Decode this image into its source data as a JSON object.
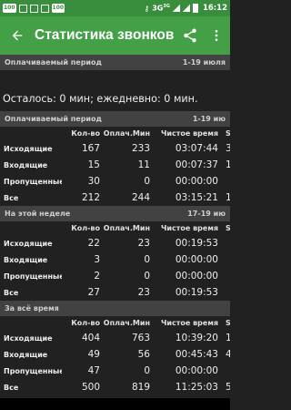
{
  "statusbar": {
    "notification_count": "100",
    "network": "3G",
    "network_sup": "3G",
    "time": "16:12"
  },
  "appbar": {
    "title": "Статистика звонков"
  },
  "billing": {
    "header_label": "Оплачиваемый период",
    "header_range": "1-19 июля",
    "remaining_text": "Осталось: 0 мин; ежедневно: 0 мин."
  },
  "columns": [
    "Кол-во",
    "Оплач.Мин",
    "Чистое время",
    "SI"
  ],
  "sections": [
    {
      "label": "Оплачиваемый период",
      "range": "1-19 ию",
      "rows": [
        {
          "label": "Исходящие",
          "count": "167",
          "paid_min": "233",
          "net_time": "03:07:44",
          "extra": "3"
        },
        {
          "label": "Входящие",
          "count": "15",
          "paid_min": "11",
          "net_time": "00:07:37",
          "extra": "1"
        },
        {
          "label": "Пропущенные",
          "count": "30",
          "paid_min": "0",
          "net_time": "00:00:00",
          "extra": ""
        },
        {
          "label": "Все",
          "count": "212",
          "paid_min": "244",
          "net_time": "03:15:21",
          "extra": "1"
        }
      ]
    },
    {
      "label": "На этой неделе",
      "range": "17-19 ию",
      "rows": [
        {
          "label": "Исходящие",
          "count": "22",
          "paid_min": "23",
          "net_time": "00:19:53",
          "extra": ""
        },
        {
          "label": "Входящие",
          "count": "3",
          "paid_min": "0",
          "net_time": "00:00:00",
          "extra": ""
        },
        {
          "label": "Пропущенные",
          "count": "2",
          "paid_min": "0",
          "net_time": "00:00:00",
          "extra": ""
        },
        {
          "label": "Все",
          "count": "27",
          "paid_min": "23",
          "net_time": "00:19:53",
          "extra": ""
        }
      ]
    },
    {
      "label": "За всё время",
      "range": "",
      "rows": [
        {
          "label": "Исходящие",
          "count": "404",
          "paid_min": "763",
          "net_time": "10:39:20",
          "extra": "1"
        },
        {
          "label": "Входящие",
          "count": "49",
          "paid_min": "56",
          "net_time": "00:45:43",
          "extra": "4"
        },
        {
          "label": "Пропущенные",
          "count": "47",
          "paid_min": "0",
          "net_time": "00:00:00",
          "extra": ""
        },
        {
          "label": "Все",
          "count": "500",
          "paid_min": "819",
          "net_time": "11:25:03",
          "extra": "5"
        }
      ]
    }
  ],
  "colors": {
    "appbar": "#43a047",
    "statusbar": "#388e3c",
    "background": "#212121",
    "section_header": "#424242"
  }
}
